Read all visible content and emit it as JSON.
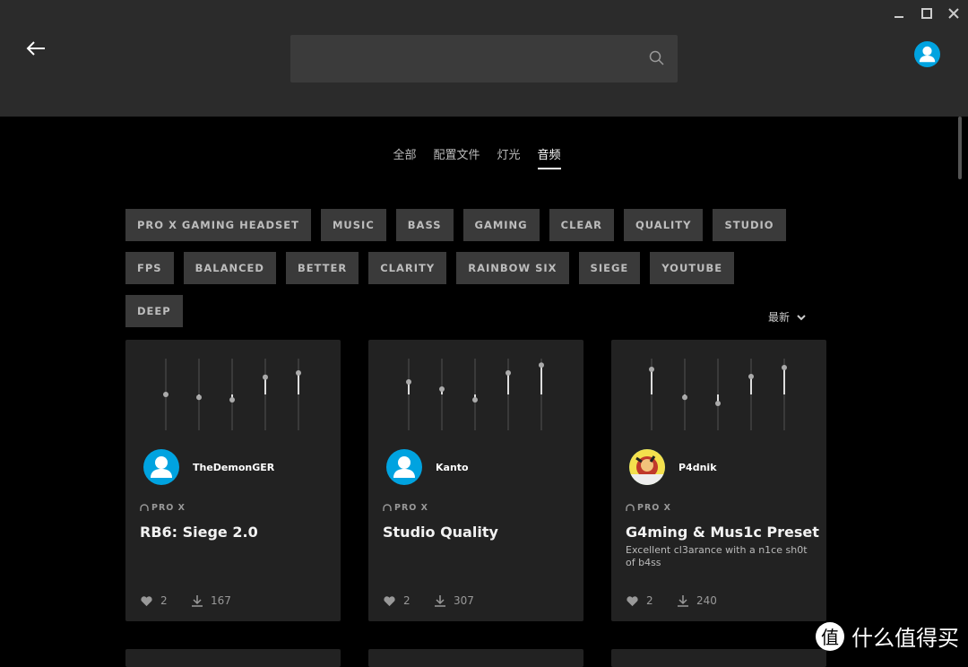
{
  "header": {
    "search_placeholder": "",
    "accent": "#00a3e0"
  },
  "tabs": [
    {
      "label": "全部"
    },
    {
      "label": "配置文件"
    },
    {
      "label": "灯光"
    },
    {
      "label": "音频",
      "active": true
    }
  ],
  "tags": [
    "PRO X GAMING HEADSET",
    "MUSIC",
    "BASS",
    "GAMING",
    "CLEAR",
    "QUALITY",
    "STUDIO",
    "FPS",
    "BALANCED",
    "BETTER",
    "CLARITY",
    "RAINBOW SIX",
    "SIEGE",
    "YOUTUBE",
    "DEEP"
  ],
  "sort": {
    "label": "最新"
  },
  "cards": [
    {
      "user": "TheDemonGER",
      "avatar": "default",
      "device": "PRO X",
      "title": "RB6: Siege 2.0",
      "description": "",
      "likes": "2",
      "downloads": "167",
      "eq_levels": [
        0,
        -0.08,
        -0.15,
        0.48,
        0.6
      ]
    },
    {
      "user": "Kanto",
      "avatar": "default",
      "device": "PRO X",
      "title": "Studio Quality",
      "description": "",
      "likes": "2",
      "downloads": "307",
      "eq_levels": [
        0.35,
        0.15,
        -0.15,
        0.6,
        0.82
      ]
    },
    {
      "user": "P4dnik",
      "avatar": "photo",
      "device": "PRO X",
      "title": "G4ming & Mus1c Preset",
      "description": "Excellent cl3arance with a n1ce sh0t of b4ss",
      "likes": "2",
      "downloads": "240",
      "eq_levels": [
        0.7,
        -0.08,
        -0.25,
        0.5,
        0.75
      ]
    }
  ],
  "watermark": {
    "badge": "值",
    "text": "什么值得买"
  }
}
